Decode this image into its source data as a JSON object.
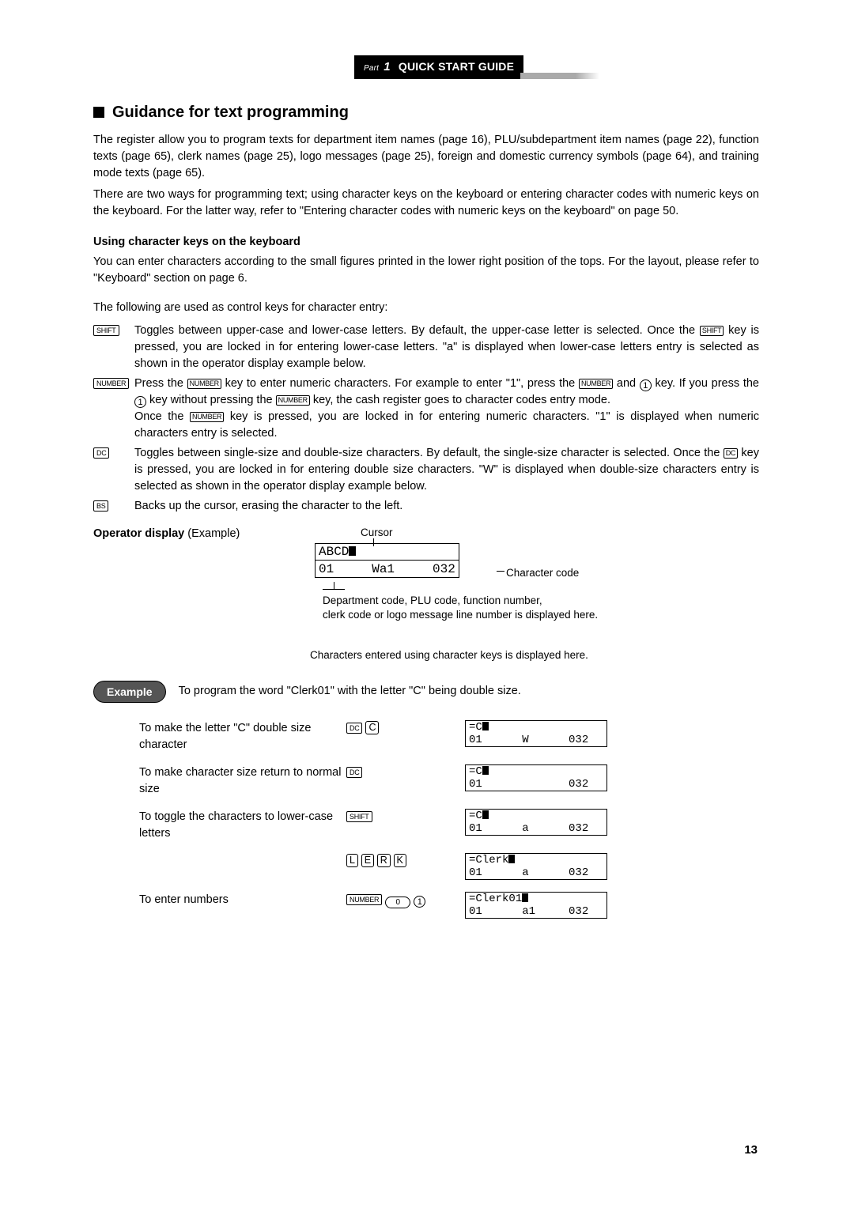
{
  "banner": {
    "part_label": "Part",
    "part_num": "1",
    "title": "QUICK START GUIDE"
  },
  "heading": "Guidance for text programming",
  "intro_p1": "The register allow you to program texts for department item names (page 16), PLU/subdepartment item names (page 22), function texts (page 65), clerk names (page 25), logo messages (page 25), foreign and domestic currency symbols (page 64), and training mode texts (page 65).",
  "intro_p2": "There are two ways for programming text; using character keys on the keyboard or entering character codes with numeric keys on the keyboard.  For the latter way, refer to \"Entering character codes with numeric keys on the keyboard\" on page 50.",
  "sub_heading": "Using character keys on the keyboard",
  "sub_intro": "You can enter characters according to the small figures printed in the lower right position of the tops.  For the layout, please refer to \"Keyboard\" section on page 6.",
  "control_lead": "The following are used as control keys for character entry:",
  "controls": {
    "shift_key": "SHIFT",
    "shift_pre": "Toggles between upper-case and lower-case letters.  By default, the upper-case letter is selected.  Once the ",
    "shift_post": " key is pressed, you are locked in for entering lower-case letters.  \"a\" is displayed when lower-case letters entry is selected as shown in the operator display example below.",
    "number_key": "NUMBER",
    "number_pre": "Press the ",
    "number_mid1": " key to enter numeric characters.  For example to enter \"1\", press the ",
    "number_mid2": " and ",
    "number_mid3": " key.  If you press the ",
    "number_mid4": " key without pressing the ",
    "number_mid5": " key, the cash register goes to character codes entry mode.",
    "number_sent2a": "Once the ",
    "number_sent2b": " key is pressed, you are locked in for entering numeric characters.  \"1\" is displayed when numeric characters entry is selected.",
    "dc_key": "DC",
    "dc_pre": "Toggles between single-size and double-size characters.  By default, the single-size character is selected.  Once the ",
    "dc_post": " key is pressed, you are locked in for entering double size characters.  \"W\"  is displayed when double-size characters entry is selected as shown in the operator display example below.",
    "bs_key": "BS",
    "bs_text": "Backs up the cursor, erasing the character to the left.",
    "one_key": "1"
  },
  "op_display": {
    "label": "Operator display",
    "label_sub": " (Example)",
    "cursor_lbl": "Cursor",
    "charcode_lbl": "Character code",
    "line1": "ABCD",
    "line2_left": "01",
    "line2_mid": "Wa1",
    "line2_right": "032",
    "under1": "Department code, PLU code, function number,\nclerk code or logo message line number is displayed here.",
    "under2": "Characters entered using character keys is displayed here."
  },
  "example": {
    "pill": "Example",
    "sentence": "To program the word \"Clerk01\" with the letter \"C\" being double size.",
    "steps": [
      {
        "desc": "To make the letter \"C\" double size character",
        "keys": [
          "DC",
          "C"
        ],
        "display": {
          "top": "=C",
          "bottom_l": "01",
          "bottom_m": "W",
          "bottom_r": "032"
        }
      },
      {
        "desc": "To make character size return to normal size",
        "keys": [
          "DC"
        ],
        "display": {
          "top": "=C",
          "bottom_l": "01",
          "bottom_m": "",
          "bottom_r": "032"
        }
      },
      {
        "desc": "To toggle the characters to lower-case letters",
        "keys": [
          "SHIFT"
        ],
        "display": {
          "top": "=C",
          "bottom_l": "01",
          "bottom_m": "a",
          "bottom_r": "032"
        }
      },
      {
        "desc": "",
        "keys": [
          "L",
          "E",
          "R",
          "K"
        ],
        "display": {
          "top": "=Clerk",
          "bottom_l": "01",
          "bottom_m": "a",
          "bottom_r": "032"
        }
      },
      {
        "desc": "To enter numbers",
        "keys": [
          "NUMBER",
          "0",
          "1"
        ],
        "display": {
          "top": "=Clerk01",
          "bottom_l": "01",
          "bottom_m": "a1",
          "bottom_r": "032"
        }
      }
    ]
  },
  "page_number": "13"
}
